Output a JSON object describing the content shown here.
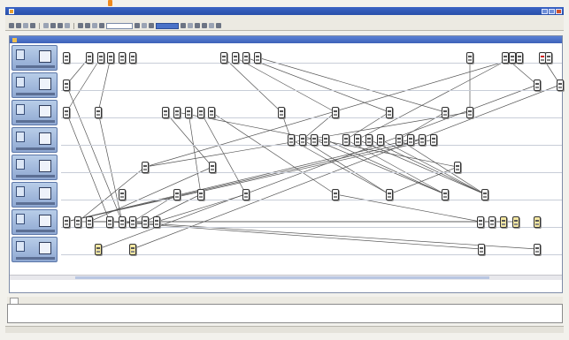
{
  "window": {
    "title": "",
    "menu": [
      "",
      "",
      "",
      "",
      "",
      "",
      "",
      "",
      ""
    ],
    "toolbar_combo": "",
    "toolbar_combo_2": ""
  },
  "child_window": {
    "title": ""
  },
  "tracks": [
    {
      "name": ""
    },
    {
      "name": ""
    },
    {
      "name": ""
    },
    {
      "name": ""
    },
    {
      "name": ""
    },
    {
      "name": ""
    },
    {
      "name": ""
    },
    {
      "name": ""
    }
  ],
  "output": {
    "tab_label": "",
    "lines": [
      ""
    ]
  },
  "status": {
    "text": ""
  },
  "colors": {
    "title_bar": "#2850aa",
    "track_head": "#8fa8d2",
    "node_border": "#333333",
    "accent_orange": "#f08a1c"
  },
  "icons": {
    "app": "app-icon",
    "node": "process-node-icon",
    "track": "track-node-icon"
  }
}
